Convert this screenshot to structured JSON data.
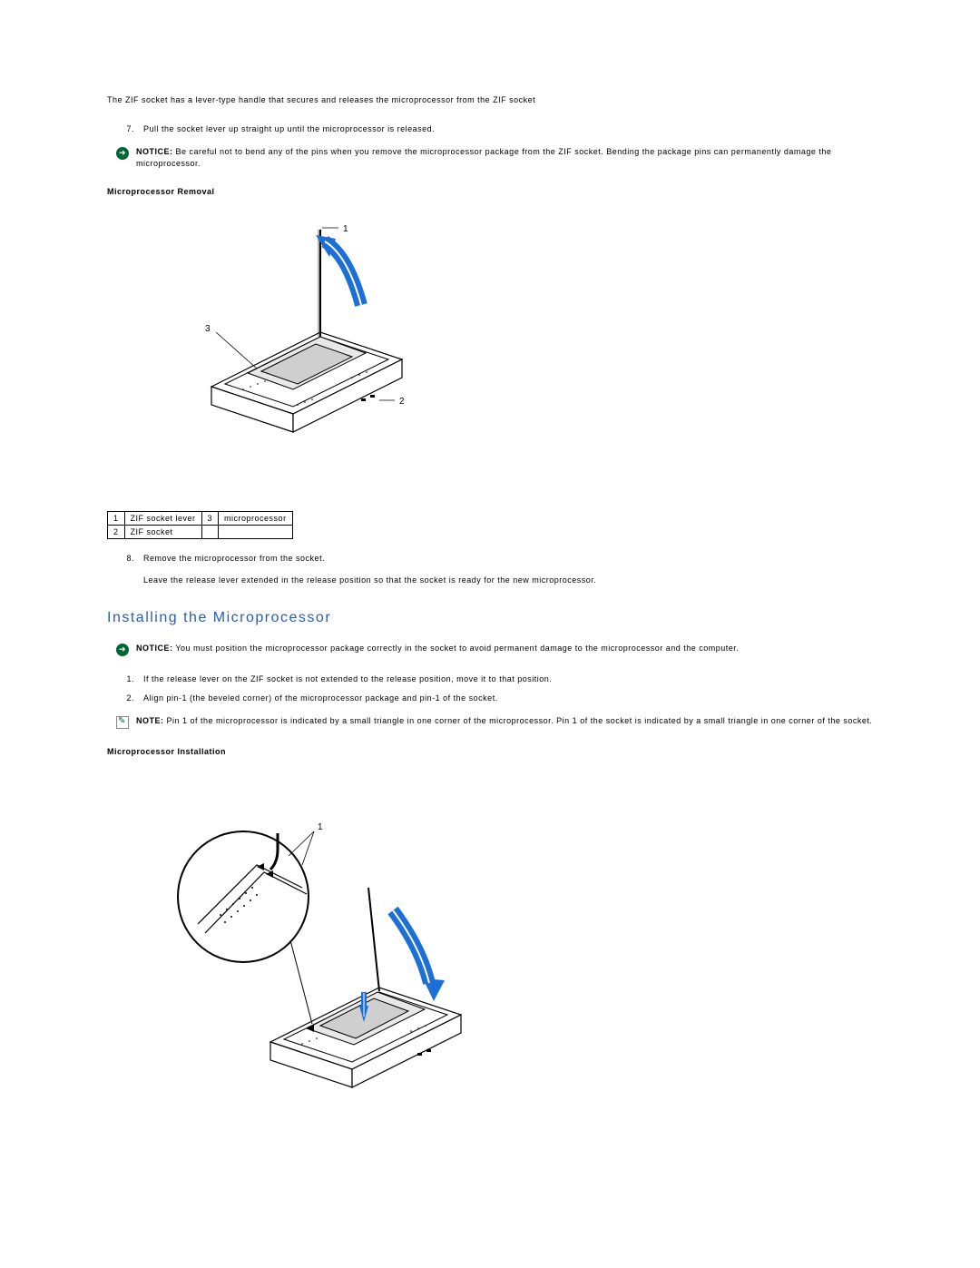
{
  "intro": "The ZIF socket has a lever-type handle that secures and releases the microprocessor from the ZIF socket",
  "step7": {
    "num": "7.",
    "text": "Pull the socket lever up straight up until the microprocessor is released."
  },
  "notice1": {
    "label": "NOTICE:",
    "text": " Be careful not to bend any of the pins when you remove the microprocessor package from the ZIF socket. Bending the package pins can permanently damage the microprocessor."
  },
  "fig1_title": "Microprocessor Removal",
  "fig1_labels": {
    "l1": "1",
    "l2": "2",
    "l3": "3"
  },
  "legend": {
    "r1c1": "1",
    "r1c2": "ZIF socket lever",
    "r1c3": "3",
    "r1c4": "microprocessor",
    "r2c1": "2",
    "r2c2": "ZIF socket",
    "r2c3": "",
    "r2c4": ""
  },
  "step8": {
    "num": "8.",
    "text": "Remove the microprocessor from the socket.",
    "sub": "Leave the release lever extended in the release position so that the socket is ready for the new microprocessor."
  },
  "section2_title": "Installing the Microprocessor",
  "notice2": {
    "label": "NOTICE:",
    "text": " You must position the microprocessor package correctly in the socket to avoid permanent damage to the microprocessor and the computer."
  },
  "install_steps": {
    "s1": {
      "num": "1.",
      "text": "If the release lever on the ZIF socket is not extended to the release position, move it to that position."
    },
    "s2": {
      "num": "2.",
      "text": "Align pin-1 (the beveled corner) of the microprocessor package and pin-1 of the socket."
    }
  },
  "note1": {
    "label": "NOTE:",
    "text": " Pin 1 of the microprocessor is indicated by a small triangle in one corner of the microprocessor. Pin 1 of the socket is indicated by a small triangle in one corner of the socket."
  },
  "fig2_title": "Microprocessor Installation",
  "fig2_label": "1"
}
